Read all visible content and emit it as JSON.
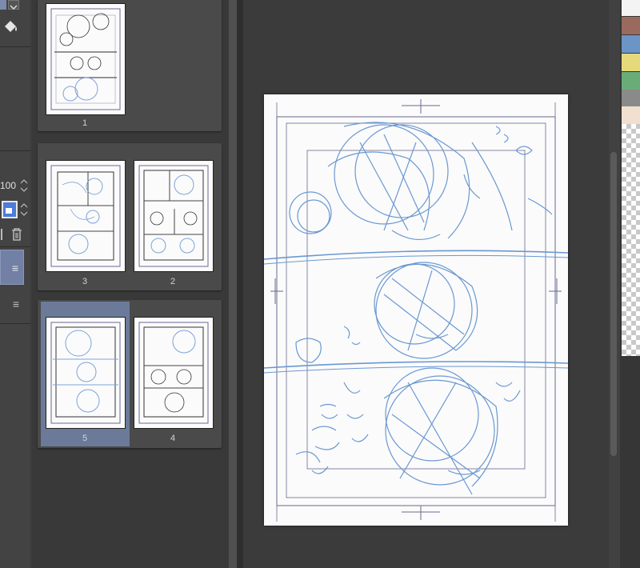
{
  "left_panel": {
    "opacity_value": "100"
  },
  "pages": [
    {
      "number": "1",
      "selected": false
    },
    {
      "number": "3",
      "selected": false
    },
    {
      "number": "2",
      "selected": false
    },
    {
      "number": "5",
      "selected": true
    },
    {
      "number": "4",
      "selected": false
    }
  ],
  "swatches": [
    "#9a6a5f",
    "#6a95c6",
    "#e6d97b",
    "#6aac78",
    "#8a8a8a",
    "#f1dfd0"
  ],
  "icons": {
    "dropdown": "chevron-down-icon",
    "fill": "fill-bucket-icon",
    "stepper": "stepper-icon",
    "trash": "trash-icon",
    "menu": "hamburger-icon"
  }
}
